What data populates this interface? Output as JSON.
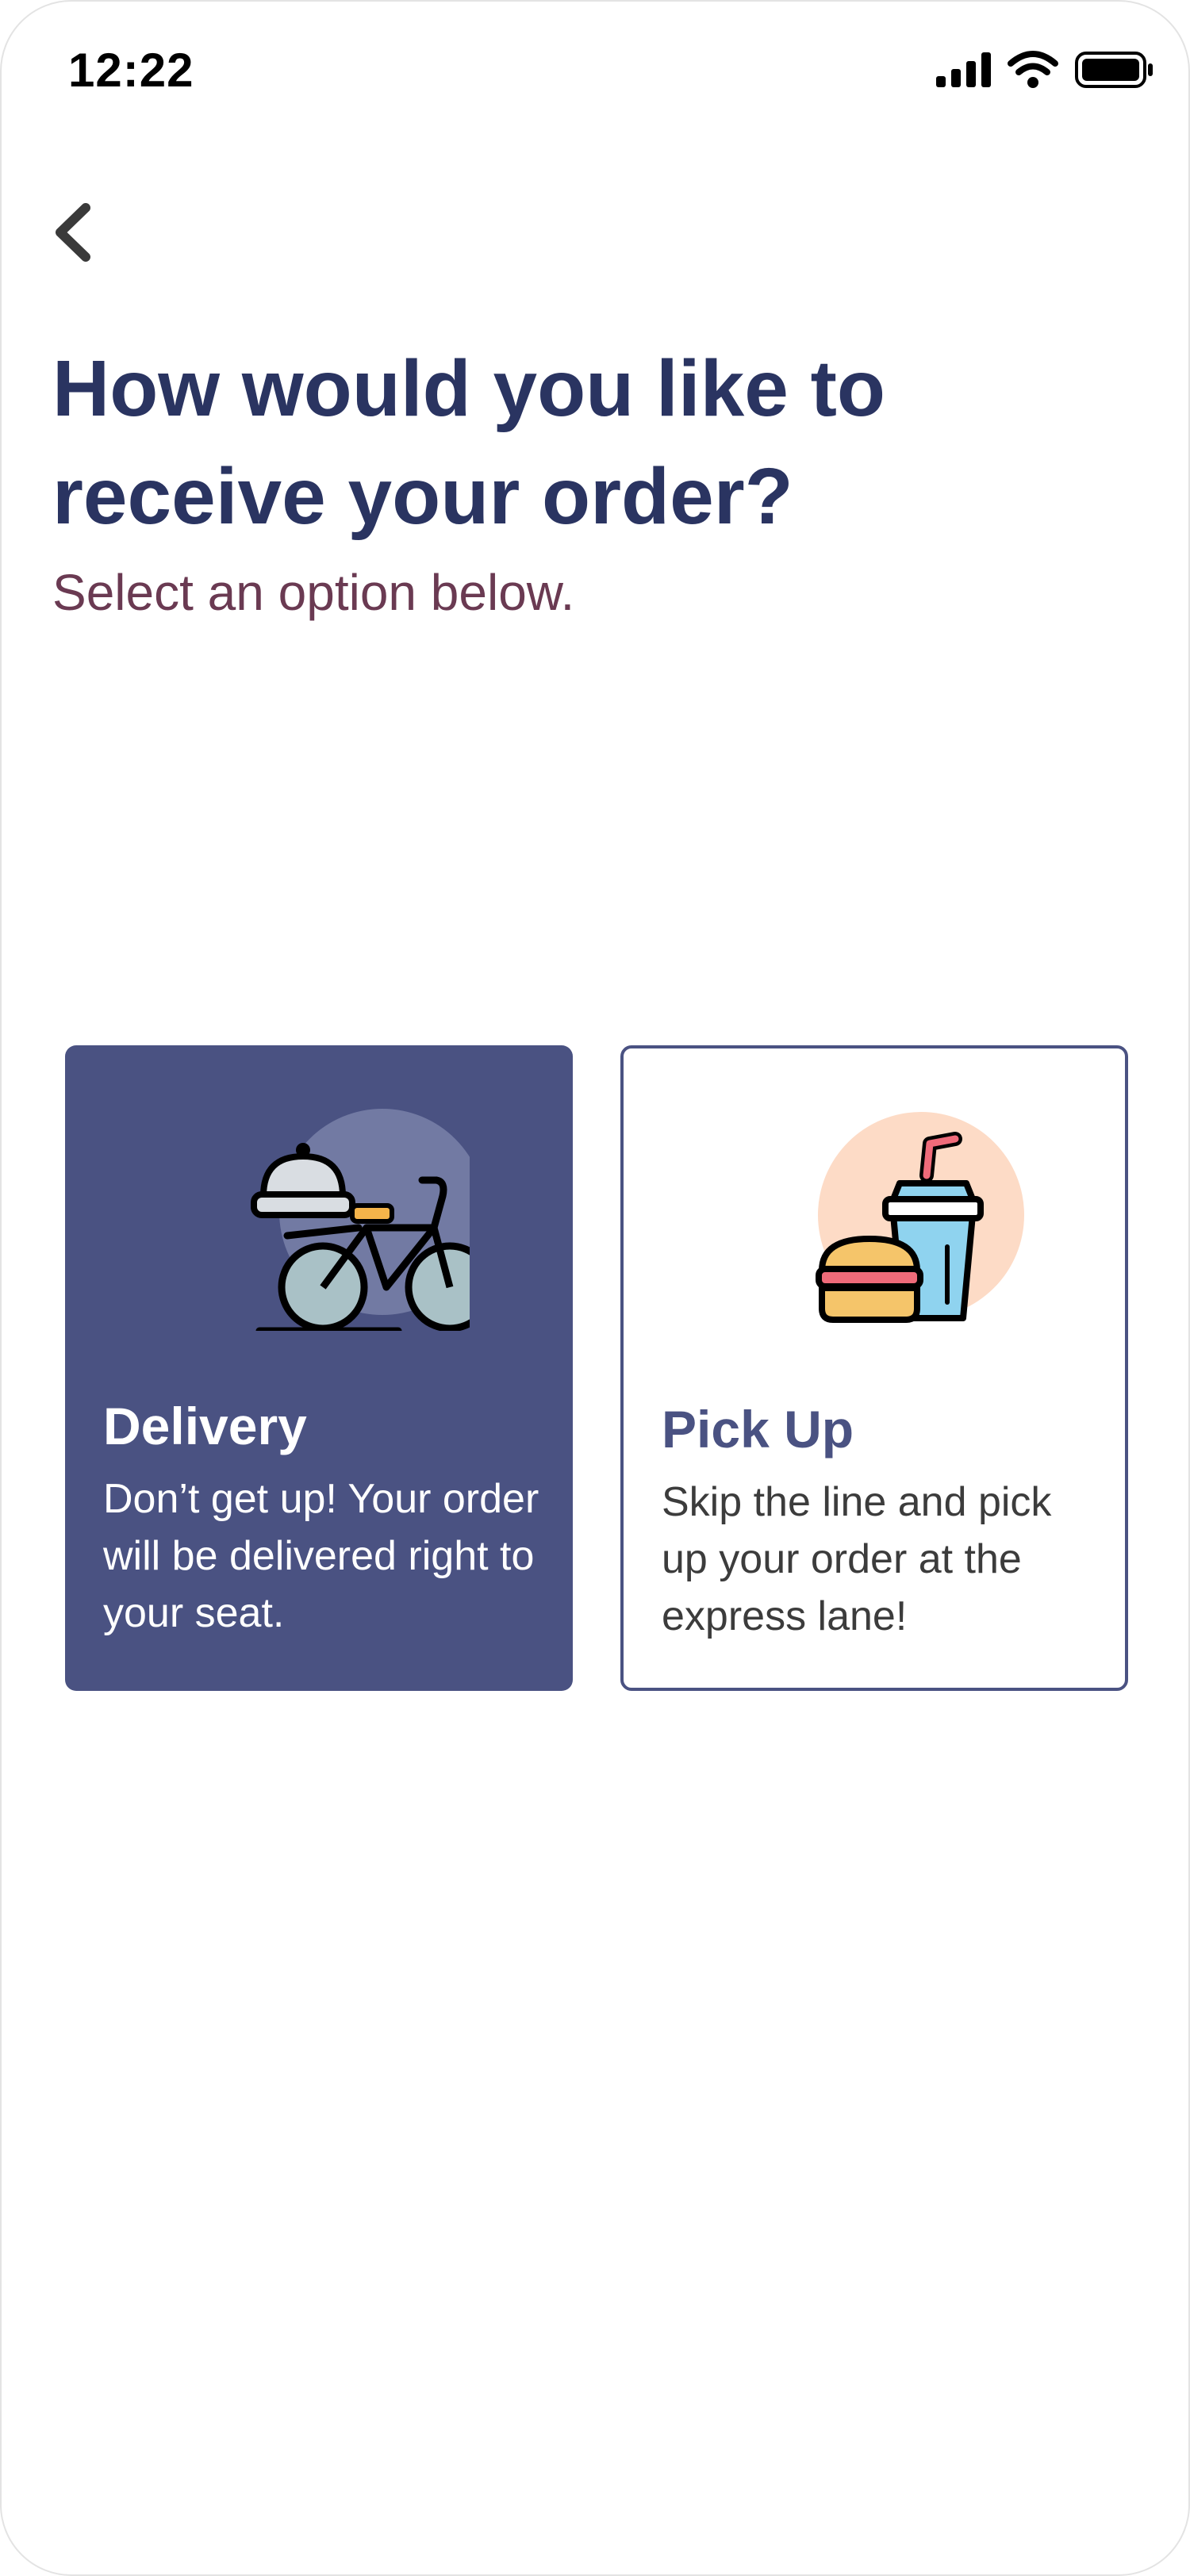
{
  "status_bar": {
    "time": "12:22",
    "icons": [
      "cellular-signal-icon",
      "wifi-icon",
      "battery-icon"
    ]
  },
  "navigation": {
    "back_icon": "chevron-left-icon"
  },
  "header": {
    "title": "How would you like to receive your order?",
    "subtitle": "Select an option below."
  },
  "options": [
    {
      "title": "Delivery",
      "description": "Don’t get up! Your order will be delivered right to your seat.",
      "icon": "delivery-bicycle-icon",
      "selected": true
    },
    {
      "title": "Pick Up",
      "description": "Skip the line and pick up your order at the express lane!",
      "icon": "burger-and-drink-icon",
      "selected": false
    }
  ],
  "colors": {
    "primary": "#4a5282",
    "title": "#2a3461",
    "subtitle": "#6a3a52",
    "background": "#ffffff"
  }
}
